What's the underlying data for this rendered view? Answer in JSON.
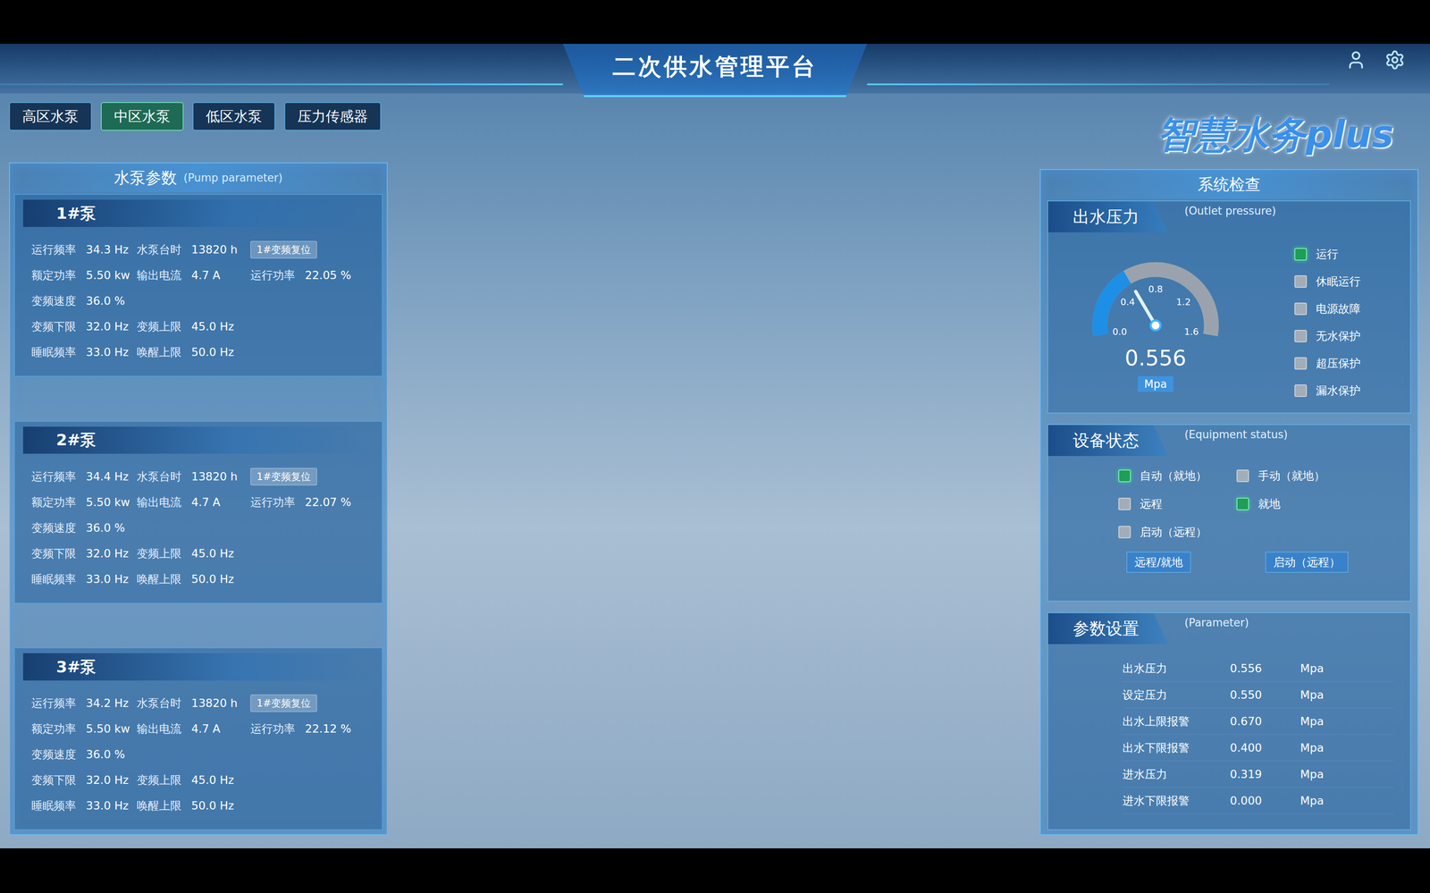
{
  "header": {
    "title": "二次供水管理平台",
    "logo": "智慧水务plus"
  },
  "tabs": [
    {
      "label": "高区水泵",
      "selected": false
    },
    {
      "label": "中区水泵",
      "selected": true
    },
    {
      "label": "低区水泵",
      "selected": false
    },
    {
      "label": "压力传感器",
      "selected": false
    }
  ],
  "pump_panel": {
    "title": "水泵参数",
    "subtitle": "(Pump parameter)",
    "pumps": [
      {
        "name": "1#泵",
        "rows": [
          [
            {
              "kind": "field",
              "label": "运行频率",
              "value": "34.3",
              "unit": "Hz"
            },
            {
              "kind": "field",
              "label": "水泵台时",
              "value": "13820",
              "unit": "h"
            },
            {
              "kind": "button",
              "label": "1#变频复位"
            }
          ],
          [
            {
              "kind": "field",
              "label": "额定功率",
              "value": "5.50",
              "unit": "kw"
            },
            {
              "kind": "field",
              "label": "输出电流",
              "value": "4.7",
              "unit": "A"
            },
            {
              "kind": "field",
              "label": "运行功率",
              "value": "22.05",
              "unit": "%"
            }
          ],
          [
            {
              "kind": "field",
              "label": "变频速度",
              "value": "36.0",
              "unit": "%"
            }
          ],
          [
            {
              "kind": "field",
              "label": "变频下限",
              "value": "32.0",
              "unit": "Hz"
            },
            {
              "kind": "field",
              "label": "变频上限",
              "value": "45.0",
              "unit": "Hz"
            }
          ],
          [
            {
              "kind": "field",
              "label": "睡眠频率",
              "value": "33.0",
              "unit": "Hz"
            },
            {
              "kind": "field",
              "label": "唤醒上限",
              "value": "50.0",
              "unit": "Hz"
            }
          ]
        ]
      },
      {
        "name": "2#泵",
        "rows": [
          [
            {
              "kind": "field",
              "label": "运行频率",
              "value": "34.4",
              "unit": "Hz"
            },
            {
              "kind": "field",
              "label": "水泵台时",
              "value": "13820",
              "unit": "h"
            },
            {
              "kind": "button",
              "label": "1#变频复位"
            }
          ],
          [
            {
              "kind": "field",
              "label": "额定功率",
              "value": "5.50",
              "unit": "kw"
            },
            {
              "kind": "field",
              "label": "输出电流",
              "value": "4.7",
              "unit": "A"
            },
            {
              "kind": "field",
              "label": "运行功率",
              "value": "22.07",
              "unit": "%"
            }
          ],
          [
            {
              "kind": "field",
              "label": "变频速度",
              "value": "36.0",
              "unit": "%"
            }
          ],
          [
            {
              "kind": "field",
              "label": "变频下限",
              "value": "32.0",
              "unit": "Hz"
            },
            {
              "kind": "field",
              "label": "变频上限",
              "value": "45.0",
              "unit": "Hz"
            }
          ],
          [
            {
              "kind": "field",
              "label": "睡眠频率",
              "value": "33.0",
              "unit": "Hz"
            },
            {
              "kind": "field",
              "label": "唤醒上限",
              "value": "50.0",
              "unit": "Hz"
            }
          ]
        ]
      },
      {
        "name": "3#泵",
        "rows": [
          [
            {
              "kind": "field",
              "label": "运行频率",
              "value": "34.2",
              "unit": "Hz"
            },
            {
              "kind": "field",
              "label": "水泵台时",
              "value": "13820",
              "unit": "h"
            },
            {
              "kind": "button",
              "label": "1#变频复位"
            }
          ],
          [
            {
              "kind": "field",
              "label": "额定功率",
              "value": "5.50",
              "unit": "kw"
            },
            {
              "kind": "field",
              "label": "输出电流",
              "value": "4.7",
              "unit": "A"
            },
            {
              "kind": "field",
              "label": "运行功率",
              "value": "22.12",
              "unit": "%"
            }
          ],
          [
            {
              "kind": "field",
              "label": "变频速度",
              "value": "36.0",
              "unit": "%"
            }
          ],
          [
            {
              "kind": "field",
              "label": "变频下限",
              "value": "32.0",
              "unit": "Hz"
            },
            {
              "kind": "field",
              "label": "变频上限",
              "value": "45.0",
              "unit": "Hz"
            }
          ],
          [
            {
              "kind": "field",
              "label": "睡眠频率",
              "value": "33.0",
              "unit": "Hz"
            },
            {
              "kind": "field",
              "label": "唤醒上限",
              "value": "50.0",
              "unit": "Hz"
            }
          ]
        ]
      }
    ]
  },
  "system_panel": {
    "title": "系统检查",
    "pressure": {
      "title": "出水压力",
      "subtitle": "(Outlet pressure)",
      "value": "0.556",
      "unit": "Mpa",
      "level": 0.3475,
      "ticks": [
        "0.0",
        "0.4",
        "0.8",
        "1.2",
        "1.6"
      ],
      "indicators": [
        {
          "label": "运行",
          "on": true,
          "color": "#1e9e57"
        },
        {
          "label": "休眠运行",
          "on": false,
          "color": "#a3adb8"
        },
        {
          "label": "电源故障",
          "on": false,
          "color": "#a3adb8"
        },
        {
          "label": "无水保护",
          "on": false,
          "color": "#a3adb8"
        },
        {
          "label": "超压保护",
          "on": false,
          "color": "#a3adb8"
        },
        {
          "label": "漏水保护",
          "on": false,
          "color": "#a3adb8"
        }
      ]
    },
    "equipment": {
      "title": "设备状态",
      "subtitle": "(Equipment status)",
      "indicators": [
        {
          "label": "自动（就地）",
          "on": true,
          "color": "#1e9e57"
        },
        {
          "label": "手动（就地）",
          "on": false,
          "color": "#a3adb8"
        },
        {
          "label": "远程",
          "on": false,
          "color": "#a3adb8"
        },
        {
          "label": "就地",
          "on": true,
          "color": "#1e9e57"
        },
        {
          "label": "启动（远程）",
          "on": false,
          "color": "#a3adb8"
        }
      ],
      "buttons": [
        "远程/就地",
        "启动（远程）"
      ]
    },
    "parameters": {
      "title": "参数设置",
      "subtitle": "(Parameter)",
      "rows": [
        {
          "label": "出水压力",
          "value": "0.556",
          "unit": "Mpa"
        },
        {
          "label": "设定压力",
          "value": "0.550",
          "unit": "Mpa"
        },
        {
          "label": "出水上限报警",
          "value": "0.670",
          "unit": "Mpa"
        },
        {
          "label": "出水下限报警",
          "value": "0.400",
          "unit": "Mpa"
        },
        {
          "label": "进水压力",
          "value": "0.319",
          "unit": "Mpa"
        },
        {
          "label": "进水下限报警",
          "value": "0.000",
          "unit": "Mpa"
        }
      ]
    }
  }
}
